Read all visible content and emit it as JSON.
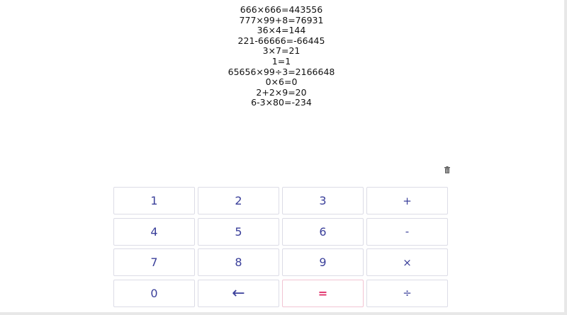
{
  "history": [
    "666×666=443556",
    "777×99+8=76931",
    "36×4=144",
    "221-66666=-66445",
    "3×7=21",
    "1=1",
    "65656×99÷3=2166648",
    "0×6=0",
    "2+2×9=20",
    "6-3×80=-234"
  ],
  "toolbar": {
    "clear_icon": "trash-icon"
  },
  "keys": {
    "k1": "1",
    "k2": "2",
    "k3": "3",
    "plus": "+",
    "k4": "4",
    "k5": "5",
    "k6": "6",
    "minus": "-",
    "k7": "7",
    "k8": "8",
    "k9": "9",
    "times": "×",
    "k0": "0",
    "backspace": "←",
    "equals": "=",
    "divide": "÷"
  },
  "colors": {
    "key_text": "#3a3f9a",
    "equals_text": "#e0306a",
    "key_border": "#dcdce6"
  }
}
